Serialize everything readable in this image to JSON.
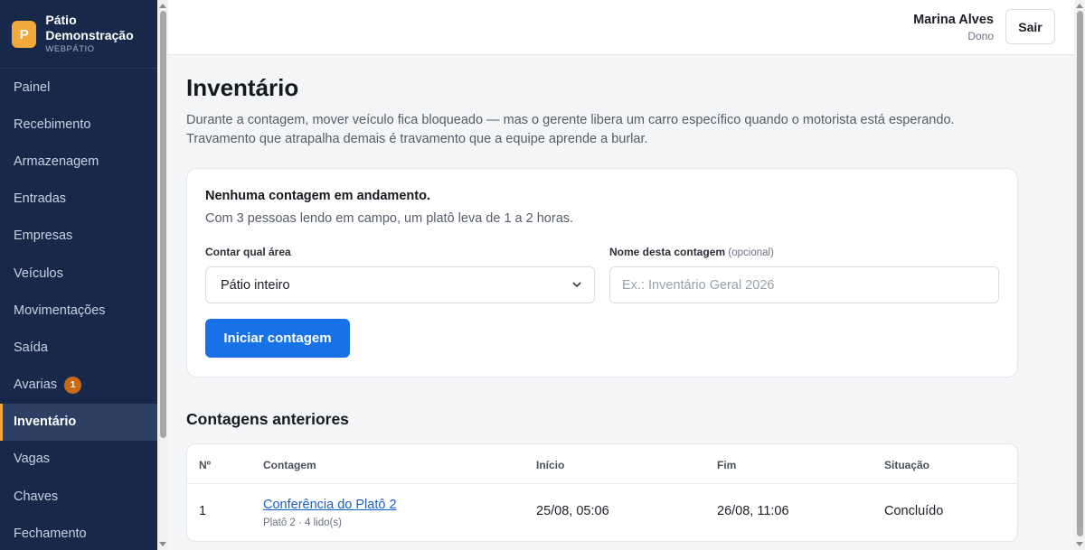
{
  "brand": {
    "logo_letter": "P",
    "name": "Pátio Demonstração",
    "subtitle": "WEBPÁTIO",
    "accent": "#f2a93b"
  },
  "sidebar": {
    "items": [
      {
        "label": "Painel"
      },
      {
        "label": "Recebimento"
      },
      {
        "label": "Armazenagem"
      },
      {
        "label": "Entradas"
      },
      {
        "label": "Empresas"
      },
      {
        "label": "Veículos"
      },
      {
        "label": "Movimentações"
      },
      {
        "label": "Saída"
      },
      {
        "label": "Avarias",
        "badge": "1"
      },
      {
        "label": "Inventário",
        "active": true
      },
      {
        "label": "Vagas"
      },
      {
        "label": "Chaves"
      },
      {
        "label": "Fechamento"
      }
    ]
  },
  "topbar": {
    "user_name": "Marina Alves",
    "user_role": "Dono",
    "logout_label": "Sair"
  },
  "page": {
    "title": "Inventário",
    "description": "Durante a contagem, mover veículo fica bloqueado — mas o gerente libera um carro específico quando o motorista está esperando. Travamento que atrapalha demais é travamento que a equipe aprende a burlar."
  },
  "count_card": {
    "title": "Nenhuma contagem em andamento.",
    "subtitle": "Com 3 pessoas lendo em campo, um platô leva de 1 a 2 horas.",
    "area_label": "Contar qual área",
    "area_value": "Pátio inteiro",
    "name_label": "Nome desta contagem",
    "name_optional": "(opcional)",
    "name_placeholder": "Ex.: Inventário Geral 2026",
    "start_label": "Iniciar contagem"
  },
  "history": {
    "title": "Contagens anteriores",
    "columns": [
      "Nº",
      "Contagem",
      "Início",
      "Fim",
      "Situação"
    ],
    "rows": [
      {
        "num": "1",
        "name": "Conferência do Platô 2",
        "detail": "Platô 2 · 4 lido(s)",
        "start": "25/08, 05:06",
        "end": "26/08, 11:06",
        "status": "Concluído"
      }
    ]
  }
}
